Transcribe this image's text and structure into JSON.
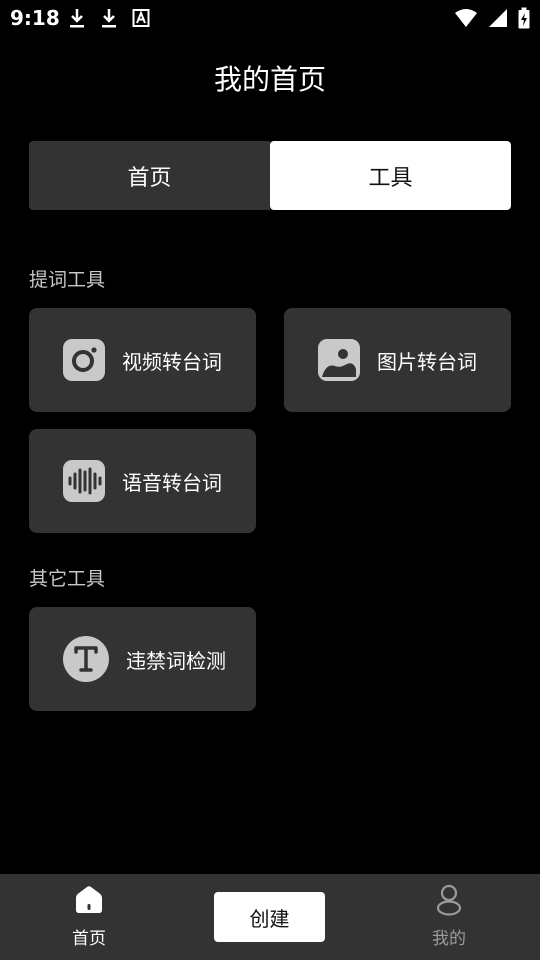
{
  "status_bar": {
    "time": "9:18",
    "left_icons": [
      "download-icon",
      "download-icon",
      "a-box-icon"
    ],
    "right_icons": [
      "wifi-icon",
      "signal-icon",
      "battery-charging-icon"
    ]
  },
  "header": {
    "title": "我的首页"
  },
  "tabs": [
    {
      "label": "首页",
      "active": false
    },
    {
      "label": "工具",
      "active": true
    }
  ],
  "sections": {
    "teleprompter_tools": {
      "label": "提词工具",
      "items": [
        {
          "label": "视频转台词",
          "icon": "camera-icon"
        },
        {
          "label": "图片转台词",
          "icon": "image-icon"
        },
        {
          "label": "语音转台词",
          "icon": "audio-wave-icon"
        }
      ]
    },
    "other_tools": {
      "label": "其它工具",
      "items": [
        {
          "label": "违禁词检测",
          "icon": "text-t-icon"
        }
      ]
    }
  },
  "bottom_nav": {
    "home_label": "首页",
    "create_label": "创建",
    "mine_label": "我的"
  },
  "colors": {
    "background": "#000000",
    "card": "#333333",
    "icon_bg": "#c9c9c9",
    "active_tab": "#ffffff",
    "inactive_nav": "#9a9a9a"
  }
}
